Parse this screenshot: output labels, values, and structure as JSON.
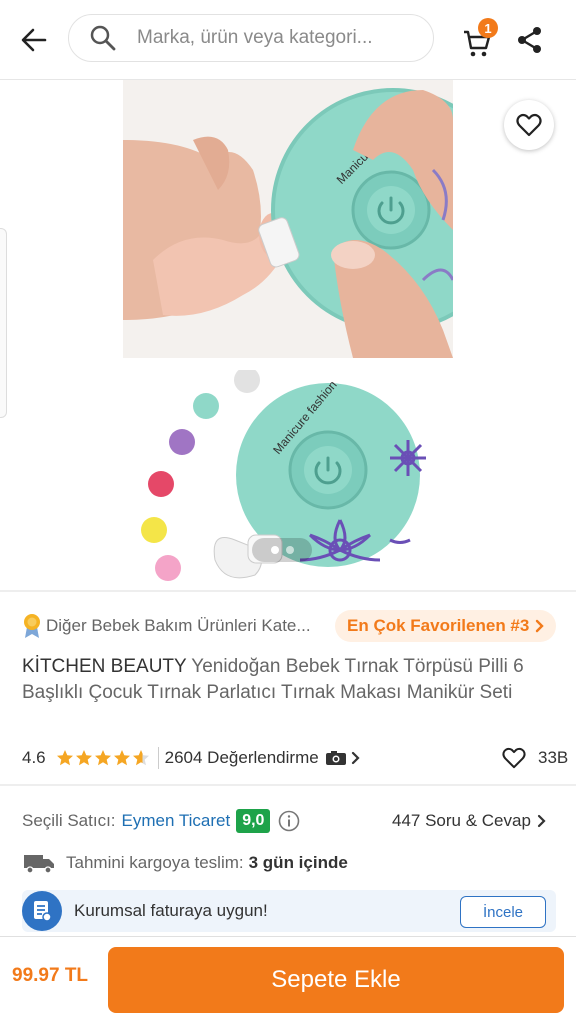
{
  "header": {
    "search_placeholder": "Marka, ürün veya kategori...",
    "cart_count": "1"
  },
  "gallery": {
    "images": [
      {
        "caption": "Manicure fashion"
      },
      {
        "caption": "Manicure fashion"
      }
    ],
    "page_count": 2,
    "active_page": 1
  },
  "product": {
    "category": "Diğer Bebek Bakım Ürünleri Kate...",
    "badge": "En Çok Favorilenen #3",
    "brand": "KİTCHEN BEAUTY",
    "name": " Yenidoğan Bebek Tırnak Törpüsü Pilli 6 Başlıklı Çocuk Tırnak Parlatıcı Tırnak Makası Manikür Seti",
    "rating": "4.6",
    "rating_value": 4.6,
    "review_count": "2604 Değerlendirme",
    "likes": "33B"
  },
  "seller": {
    "label": "Seçili Satıcı:",
    "name": "Eymen Ticaret",
    "score": "9,0",
    "qa_link": "447 Soru & Cevap"
  },
  "delivery": {
    "label": "Tahmini kargoya teslim:",
    "value": "3 gün içinde"
  },
  "corporate": {
    "text": "Kurumsal faturaya uygun!",
    "button": "İncele"
  },
  "bottom": {
    "price": "99.97 TL",
    "add_to_cart": "Sepete Ekle"
  },
  "colors": {
    "accent": "#f27a1a",
    "link": "#1e6fb3",
    "score_green": "#1ea34a",
    "corporate_blue": "#2f73c4",
    "device_mint": "#8fd8c8"
  }
}
